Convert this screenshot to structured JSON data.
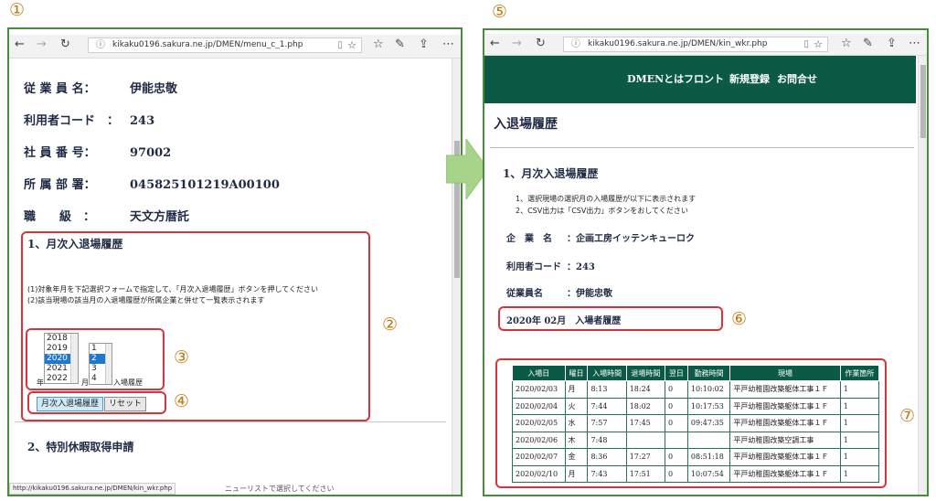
{
  "markers": [
    "①",
    "②",
    "③",
    "④",
    "⑤",
    "⑥",
    "⑦"
  ],
  "left_window": {
    "url": "kikaku0196.sakura.ne.jp/DMEN/menu_c_1.php",
    "info_rows": [
      {
        "label": "従 業 員 名：",
        "value": "伊能忠敬"
      },
      {
        "label": "利用者コード　：",
        "value": "243"
      },
      {
        "label": "社 員 番 号：",
        "value": "97002"
      },
      {
        "label": "所 属 部 署：",
        "value": "045825101219A00100"
      },
      {
        "label": "職　　級　：",
        "value": "天文方暦託"
      }
    ],
    "section1_title": "1、月次入退場履歴",
    "instr1": "(1)対象年月を下記選択フォームで指定して、「月次入退場履歴」ボタンを押してください",
    "instr2": "(2)該当現場の該当月の入退場履歴が所属企業と併せて一覧表示されます",
    "years": [
      "2018",
      "2019",
      "2020",
      "2021",
      "2022"
    ],
    "selected_year": "2020",
    "months": [
      "1",
      "2",
      "3",
      "4"
    ],
    "selected_month": "2",
    "year_label": "年",
    "month_label": "月",
    "history_label": "入場履歴",
    "monthly_button": "月次入退場履歴",
    "reset_button": "リセット",
    "section2_title": "2、特別休暇取得申請",
    "status_url": "http://kikaku0196.sakura.ne.jp/DMEN/kin_wkr.php",
    "status_partial": "ニューリストで選択してください"
  },
  "right_window": {
    "url": "kikaku0196.sakura.ne.jp/DMEN/kin_wkr.php",
    "nav": [
      "DMENとは",
      "フロント",
      "新規登録",
      "お問合せ"
    ],
    "page_title": "入退場履歴",
    "section_title": "1、月次入退場履歴",
    "note1": "1、選択現場の選択月の入場履歴が以下に表示されます",
    "note2": "2、CSV出力は「CSV出力」ボタンをおしてください",
    "company_label": "企　業　名",
    "company_value": "：企画工房イッテンキューロク",
    "user_code_label": "利用者コード",
    "user_code_value": "：243",
    "employee_label": "従業員名",
    "employee_value": "：伊能忠敬",
    "month_heading": "2020年 02月　入場者履歴",
    "table": {
      "headers": [
        "入場日",
        "曜日",
        "入場時間",
        "退場時間",
        "翌日",
        "勤務時間",
        "現場",
        "作業箇所"
      ],
      "rows": [
        [
          "2020/02/03",
          "月",
          "8:13",
          "18:24",
          "0",
          "10:10:02",
          "平戸幼稚園改築躯体工事１Ｆ",
          "1"
        ],
        [
          "2020/02/04",
          "火",
          "7:44",
          "18:02",
          "0",
          "10:17:53",
          "平戸幼稚園改築躯体工事１Ｆ",
          "1"
        ],
        [
          "2020/02/05",
          "水",
          "7:57",
          "17:45",
          "0",
          "09:47:35",
          "平戸幼稚園改築躯体工事１Ｆ",
          "1"
        ],
        [
          "2020/02/06",
          "木",
          "7:48",
          "",
          "",
          "",
          "平戸幼稚園改築空調工事",
          "1"
        ],
        [
          "2020/02/07",
          "金",
          "8:36",
          "17:27",
          "0",
          "08:51:18",
          "平戸幼稚園改築躯体工事１Ｆ",
          "1"
        ],
        [
          "2020/02/10",
          "月",
          "7:43",
          "17:51",
          "0",
          "10:07:54",
          "平戸幼稚園改築躯体工事１Ｆ",
          "1"
        ]
      ]
    }
  },
  "colors": {
    "window_border": "#4a8a3c",
    "marker": "#c07a10",
    "highlight_box": "#d9343c",
    "header_bar": "#0b5a46",
    "arrow": "#a6d58a"
  }
}
